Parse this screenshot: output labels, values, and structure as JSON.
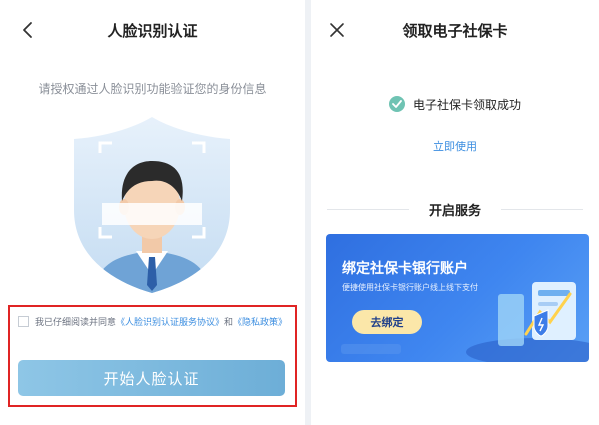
{
  "left": {
    "title": "人脸识别认证",
    "hint": "请授权通过人脸识别功能验证您的身份信息",
    "agreement": {
      "prefix": "我已仔细阅读并同意",
      "link1": "《人脸识别认证服务协议》",
      "middle": "和",
      "link2": "《隐私政策》"
    },
    "start_button": "开始人脸认证",
    "icons": {
      "back": "chevron-left-icon",
      "checkbox": "checkbox-unchecked"
    }
  },
  "right": {
    "title": "领取电子社保卡",
    "success_text": "电子社保卡领取成功",
    "use_link": "立即使用",
    "section_title": "开启服务",
    "banner": {
      "title": "绑定社保卡银行账户",
      "subtitle": "便捷使用社保卡银行账户线上线下支付",
      "button": "去绑定"
    },
    "icons": {
      "close": "close-icon",
      "success": "check-circle-icon"
    }
  },
  "colors": {
    "link_blue": "#3c8ee0",
    "button_gradient_start": "#8ec6e6",
    "button_gradient_end": "#6daed7",
    "highlight_red": "#e02424",
    "success_green": "#6fc3b3",
    "banner_blue": "#2f6fe0",
    "banner_button": "#fbe7a9"
  }
}
